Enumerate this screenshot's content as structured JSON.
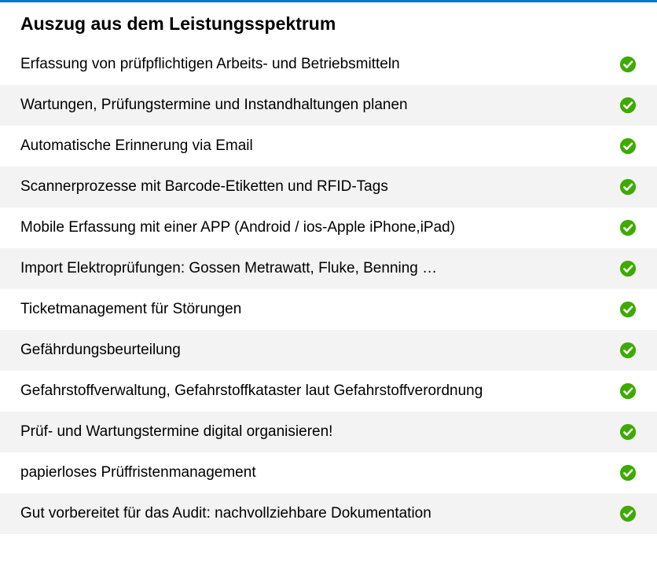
{
  "title": "Auszug aus dem Leistungsspektrum",
  "items": [
    {
      "label": "Erfassung von prüfpflichtigen Arbeits- und Betriebsmitteln"
    },
    {
      "label": "Wartungen, Prüfungstermine und Instandhaltungen planen"
    },
    {
      "label": "Automatische Erinnerung via Email"
    },
    {
      "label": "Scannerprozesse mit Barcode-Etiketten und RFID-Tags"
    },
    {
      "label": "Mobile Erfassung mit einer APP (Android / ios-Apple iPhone,iPad)"
    },
    {
      "label": "Import Elektroprüfungen: Gossen Metrawatt, Fluke, Benning …"
    },
    {
      "label": "Ticketmanagement für Störungen"
    },
    {
      "label": "Gefährdungsbeurteilung"
    },
    {
      "label": "Gefahrstoffverwaltung, Gefahrstoffkataster laut Gefahrstoffverordnung"
    },
    {
      "label": "Prüf- und Wartungstermine digital organisieren!"
    },
    {
      "label": "papierloses Prüffristenmanagement"
    },
    {
      "label": "Gut vorbereitet für das Audit: nachvollziehbare Dokumentation"
    }
  ],
  "colors": {
    "accent": "#0078d4",
    "checkGreen": "#3eaa00"
  }
}
